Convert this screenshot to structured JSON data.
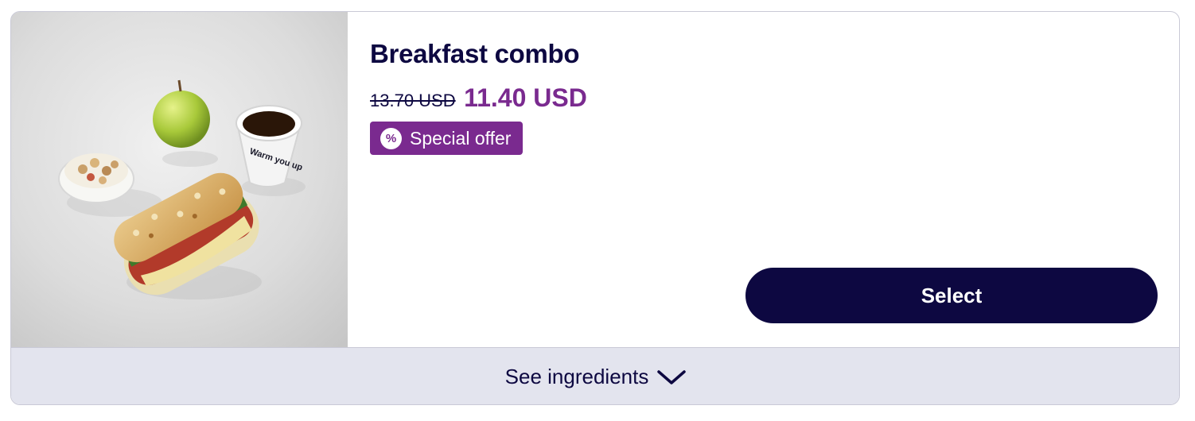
{
  "product": {
    "title": "Breakfast combo",
    "image_alt": "breakfast-combo-photo",
    "cup_text": "Warm you up",
    "old_price": "13.70 USD",
    "new_price": "11.40 USD",
    "offer_symbol": "%",
    "offer_label": "Special offer",
    "select_label": "Select",
    "ingredients_label": "See ingredients"
  },
  "colors": {
    "navy": "#0d0841",
    "purple": "#7a2a8f",
    "ingredients_bg": "#e3e4ee",
    "border": "#c9c9d6"
  },
  "icons": {
    "offer": "percent-icon",
    "expand": "chevron-down-icon"
  }
}
